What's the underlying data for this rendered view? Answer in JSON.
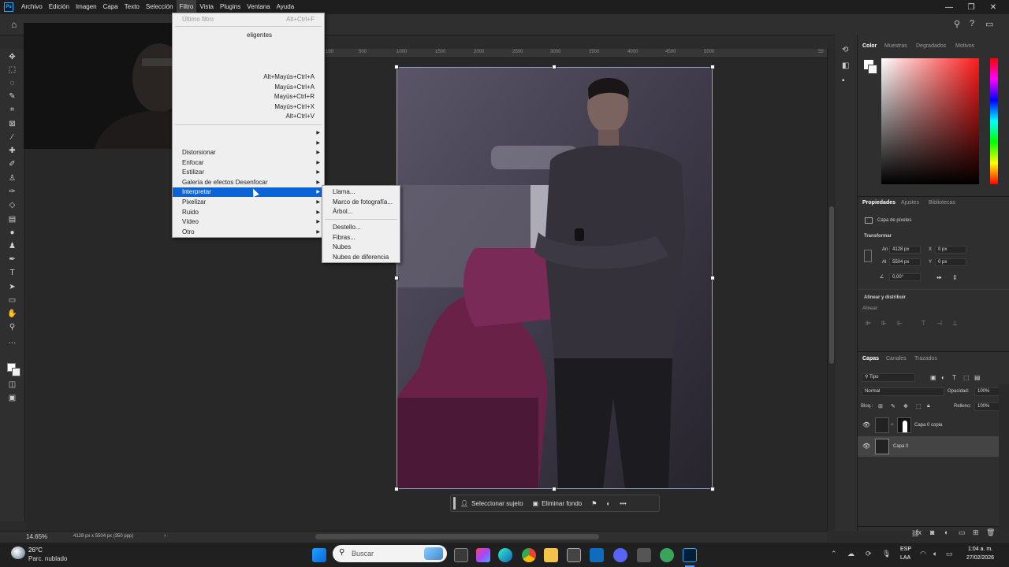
{
  "menubar": {
    "items": [
      "Archivo",
      "Edición",
      "Imagen",
      "Capa",
      "Texto",
      "Selección",
      "Filtro",
      "Vista",
      "Plugins",
      "Ventana",
      "Ayuda"
    ],
    "active": "Filtro"
  },
  "filter_menu": {
    "items": [
      {
        "label": "Último filtro",
        "shortcut": "Alt+Ctrl+F",
        "disabled": true
      },
      {
        "label": "eligentes",
        "shortcut": ""
      },
      {
        "label": "",
        "shortcut": "Alt+Mayús+Ctrl+A"
      },
      {
        "label": "",
        "shortcut": "Mayús+Ctrl+A"
      },
      {
        "label": "",
        "shortcut": "Mayús+Ctrl+R"
      },
      {
        "label": "",
        "shortcut": "Mayús+Ctrl+X"
      },
      {
        "label": "",
        "shortcut": "Alt+Ctrl+V"
      },
      {
        "label": "Distorsionar",
        "submenu": true
      },
      {
        "label": "Enfocar",
        "submenu": true
      },
      {
        "label": "Estilizar",
        "submenu": true
      },
      {
        "label": "Galería de efectos Desenfocar",
        "submenu": true
      },
      {
        "label": "Interpretar",
        "submenu": true,
        "highlighted": true
      },
      {
        "label": "Pixelizar",
        "submenu": true
      },
      {
        "label": "Ruido",
        "submenu": true
      },
      {
        "label": "Vídeo",
        "submenu": true
      },
      {
        "label": "Otro",
        "submenu": true
      }
    ]
  },
  "submenu": {
    "items": [
      "Llama...",
      "Marco de fotografía...",
      "Árbol...",
      "Destello...",
      "Fibras...",
      "Nubes",
      "Nubes de diferencia"
    ]
  },
  "ruler": {
    "ticks": [
      "100",
      "500",
      "1000",
      "1500",
      "2000",
      "2500",
      "3000",
      "3500",
      "4000",
      "4500",
      "5000",
      "55"
    ]
  },
  "context_bar": {
    "select_subject": "Seleccionar sujeto",
    "remove_bg": "Eliminar fondo"
  },
  "status": {
    "zoom": "14.65%",
    "doc_info": "4128 px x 5504 px (350 ppp)"
  },
  "color_panel": {
    "tabs": [
      "Color",
      "Muestras",
      "Degradados",
      "Motivos"
    ]
  },
  "properties": {
    "tabs": [
      "Propiedades",
      "Ajustes",
      "Bibliotecas"
    ],
    "layer_type": "Capa de píxeles",
    "transform_title": "Transformar",
    "w_label": "An",
    "w": "4128 px",
    "x_label": "X",
    "x": "0 px",
    "h_label": "Al",
    "h": "5504 px",
    "y_label": "Y",
    "y": "0 px",
    "angle": "0,00°",
    "align_title": "Alinear y distribuir",
    "align_label": "Alinear:"
  },
  "layers_panel": {
    "tabs": [
      "Capas",
      "Canales",
      "Trazados"
    ],
    "filter": "Tipo",
    "blend": "Normal",
    "opacity_label": "Opacidad:",
    "opacity": "100%",
    "lock_label": "Bloq.:",
    "fill_label": "Relleno:",
    "fill": "100%",
    "layers": [
      {
        "name": "Capa 0 copia"
      },
      {
        "name": "Capa 0"
      }
    ]
  },
  "taskbar": {
    "weather_temp": "26°C",
    "weather_desc": "Parc. nublado",
    "search_placeholder": "Buscar",
    "lang": "ESP",
    "lang2": "LAA",
    "time": "1:04 a. m.",
    "date": "27/02/2026"
  },
  "colors": {
    "accent": "#0a64d6",
    "panel": "#2f2f2f",
    "canvas_bg": "#282828"
  }
}
